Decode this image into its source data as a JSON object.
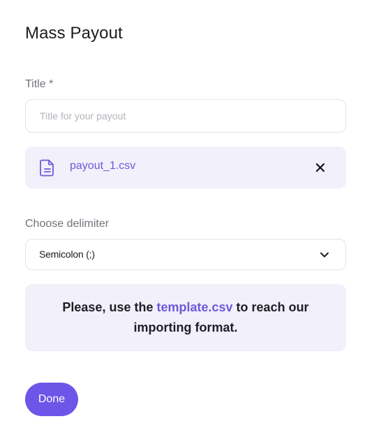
{
  "page": {
    "title": "Mass Payout"
  },
  "form": {
    "title_label": "Title *",
    "title_placeholder": "Title for your payout",
    "title_value": "",
    "file": {
      "name": "payout_1.csv",
      "file_icon": "document-icon",
      "remove_icon": "close-icon"
    },
    "delimiter_label": "Choose delimiter",
    "delimiter_value": "Semicolon (;)",
    "delimiter_icon": "chevron-down-icon"
  },
  "info": {
    "text_before": "Please, use the ",
    "link_text": "template.csv",
    "text_after": " to reach our importing format."
  },
  "actions": {
    "done_label": "Done"
  },
  "colors": {
    "accent": "#6d55e8",
    "accent_text": "#6e59d9",
    "card_bg": "#f1f0fb",
    "border": "#e3e3ea"
  }
}
